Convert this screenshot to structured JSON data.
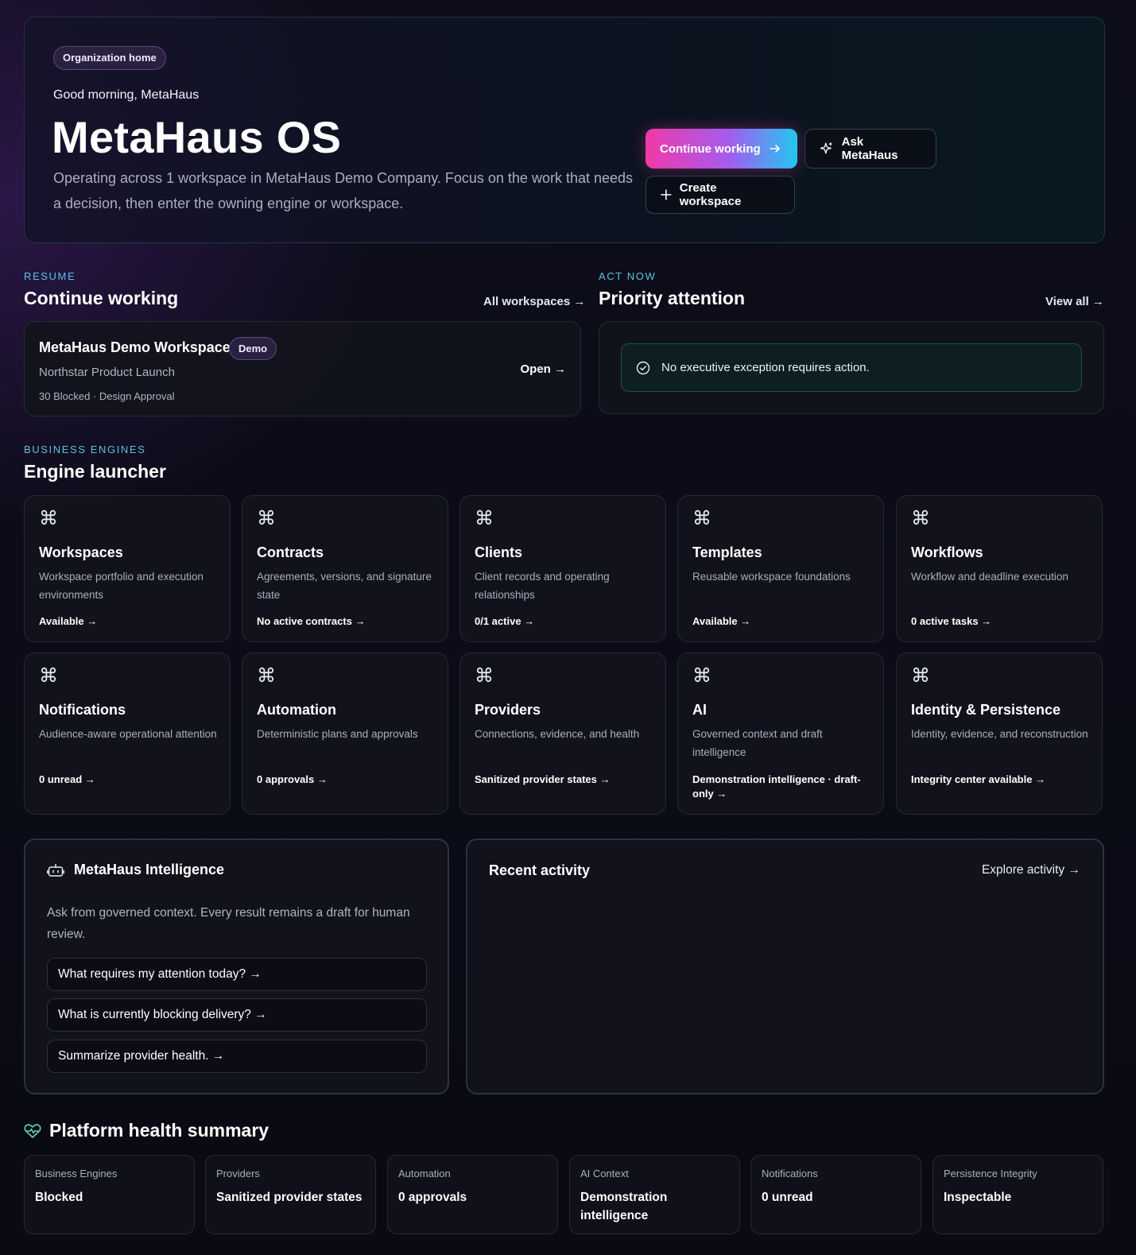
{
  "hero": {
    "tag": "Organization home",
    "greeting": "Good morning, MetaHaus",
    "title": "MetaHaus OS",
    "description": "Operating across 1 workspace in MetaHaus Demo Company. Focus on the work that needs a decision, then enter the owning engine or workspace.",
    "continue_label": "Continue working",
    "ask_label": "Ask MetaHaus",
    "create_label": "Create workspace"
  },
  "resume": {
    "eyebrow": "RESUME",
    "title": "Continue working",
    "link": "All workspaces →",
    "workspace": {
      "name": "MetaHaus Demo Workspace",
      "badge": "Demo",
      "project": "Northstar Product Launch",
      "meta": "30 Blocked · Design Approval",
      "open_label": "Open →"
    }
  },
  "priority": {
    "eyebrow": "ACT NOW",
    "title": "Priority attention",
    "link": "View all →",
    "message": "No executive exception requires action."
  },
  "engines": {
    "eyebrow": "BUSINESS ENGINES",
    "title": "Engine launcher",
    "items": [
      {
        "icon": "⌘",
        "title": "Workspaces",
        "desc": "Workspace portfolio and execution environments",
        "status": "Available →"
      },
      {
        "icon": "⌘",
        "title": "Contracts",
        "desc": "Agreements, versions, and signature state",
        "status": "No active contracts →"
      },
      {
        "icon": "⌘",
        "title": "Clients",
        "desc": "Client records and operating relationships",
        "status": "0/1 active →"
      },
      {
        "icon": "⌘",
        "title": "Templates",
        "desc": "Reusable workspace foundations",
        "status": "Available →"
      },
      {
        "icon": "⌘",
        "title": "Workflows",
        "desc": "Workflow and deadline execution",
        "status": "0 active tasks →"
      },
      {
        "icon": "⌘",
        "title": "Notifications",
        "desc": "Audience-aware operational attention",
        "status": "0 unread →"
      },
      {
        "icon": "⌘",
        "title": "Automation",
        "desc": "Deterministic plans and approvals",
        "status": "0 approvals →"
      },
      {
        "icon": "⌘",
        "title": "Providers",
        "desc": "Connections, evidence, and health",
        "status": "Sanitized provider states →"
      },
      {
        "icon": "⌘",
        "title": "AI",
        "desc": "Governed context and draft intelligence",
        "status": "Demonstration intelligence · draft-only →"
      },
      {
        "icon": "⌘",
        "title": "Identity & Persistence",
        "desc": "Identity, evidence, and reconstruction",
        "status": "Integrity center available →"
      }
    ]
  },
  "intelligence": {
    "title": "MetaHaus Intelligence",
    "description": "Ask from governed context. Every result remains a draft for human review.",
    "prompts": [
      "What requires my attention today? →",
      "What is currently blocking delivery? →",
      "Summarize provider health. →"
    ]
  },
  "activity": {
    "title": "Recent activity",
    "link": "Explore activity →"
  },
  "health": {
    "title": "Platform health summary",
    "items": [
      {
        "label": "Business Engines",
        "value": "Blocked"
      },
      {
        "label": "Providers",
        "value": "Sanitized provider states"
      },
      {
        "label": "Automation",
        "value": "0 approvals"
      },
      {
        "label": "AI Context",
        "value": "Demonstration intelligence"
      },
      {
        "label": "Notifications",
        "value": "0 unread"
      },
      {
        "label": "Persistence Integrity",
        "value": "Inspectable"
      }
    ]
  },
  "colors": {
    "accent_cyan": "#59c3e6",
    "accent_pink": "#f03aa6",
    "success_teal": "#1f5048"
  }
}
